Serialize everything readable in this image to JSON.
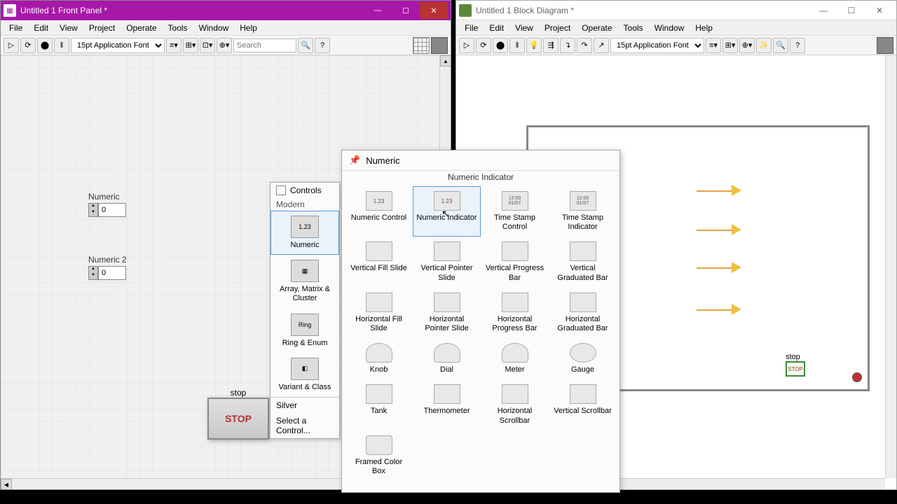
{
  "left": {
    "title": "Untitled 1 Front Panel *",
    "menu": [
      "File",
      "Edit",
      "View",
      "Project",
      "Operate",
      "Tools",
      "Window",
      "Help"
    ],
    "font": "15pt Application Font",
    "search_ph": "Search",
    "numeric1": {
      "label": "Numeric",
      "value": "0"
    },
    "numeric2": {
      "label": "Numeric 2",
      "value": "0"
    },
    "stop": {
      "label": "stop",
      "btn": "STOP"
    }
  },
  "right": {
    "title": "Untitled 1 Block Diagram *",
    "menu": [
      "File",
      "Edit",
      "View",
      "Project",
      "Operate",
      "Tools",
      "Window",
      "Help"
    ],
    "font": "15pt Application Font",
    "stop": "stop"
  },
  "controls_palette": {
    "title": "Controls",
    "category": "Modern",
    "items": [
      {
        "label": "Numeric"
      },
      {
        "label": "Array, Matrix & Cluster"
      },
      {
        "label": "Ring & Enum"
      },
      {
        "label": "Variant & Class"
      }
    ],
    "footer": [
      "Silver",
      "Select a Control..."
    ]
  },
  "numeric_palette": {
    "title": "Numeric",
    "subtitle": "Numeric Indicator",
    "items": [
      {
        "label": "Numeric Control",
        "ic": "1.23"
      },
      {
        "label": "Numeric Indicator",
        "ic": "1.23",
        "sel": true
      },
      {
        "label": "Time Stamp Control",
        "ic": "ts"
      },
      {
        "label": "Time Stamp Indicator",
        "ic": "ts"
      },
      {
        "label": "Vertical Fill Slide",
        "ic": "vs"
      },
      {
        "label": "Vertical Pointer Slide",
        "ic": "vs"
      },
      {
        "label": "Vertical Progress Bar",
        "ic": "vs"
      },
      {
        "label": "Vertical Graduated Bar",
        "ic": "vs"
      },
      {
        "label": "Horizontal Fill Slide",
        "ic": "hs"
      },
      {
        "label": "Horizontal Pointer Slide",
        "ic": "hs"
      },
      {
        "label": "Horizontal Progress Bar",
        "ic": "hs"
      },
      {
        "label": "Horizontal Graduated Bar",
        "ic": "hs"
      },
      {
        "label": "Knob",
        "ic": "knob"
      },
      {
        "label": "Dial",
        "ic": "knob"
      },
      {
        "label": "Meter",
        "ic": "meter"
      },
      {
        "label": "Gauge",
        "ic": "gauge"
      },
      {
        "label": "Tank",
        "ic": "tank"
      },
      {
        "label": "Thermometer",
        "ic": "therm"
      },
      {
        "label": "Horizontal Scrollbar",
        "ic": "scroll"
      },
      {
        "label": "Vertical Scrollbar",
        "ic": "vs"
      },
      {
        "label": "Framed Color Box",
        "ic": "color"
      }
    ]
  }
}
